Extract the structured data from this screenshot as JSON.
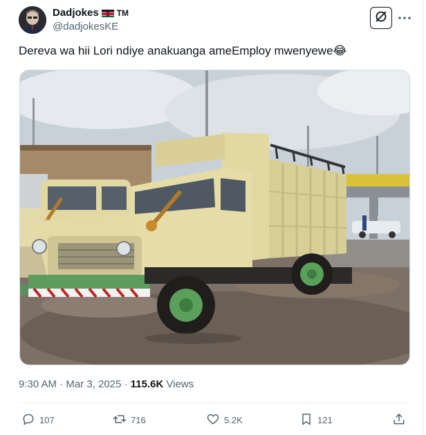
{
  "tweet": {
    "author_name": "Dadjokes",
    "author_suffix": "TM",
    "author_handle": "@dadjokesKE",
    "text": "Dereva wa hii Lori ndiye anakuanga ameEmploy mwenyewe😂",
    "time": "9:30 AM",
    "date": "Mar 3, 2025",
    "views_count": "115.6K",
    "views_label": "Views"
  },
  "actions": {
    "replies": "107",
    "reposts": "716",
    "likes": "5.2K",
    "bookmarks": "121"
  },
  "icons": {
    "header": [
      "grok-icon",
      "more-options-icon"
    ],
    "actions": [
      "reply-icon",
      "repost-icon",
      "like-icon",
      "bookmark-icon",
      "share-icon"
    ],
    "flag": "kenya-flag-icon"
  },
  "colors": {
    "text_primary": "#0f1419",
    "text_secondary": "#536471",
    "truck_body": "#e6dca8",
    "wheel_green": "#5aa05a"
  }
}
